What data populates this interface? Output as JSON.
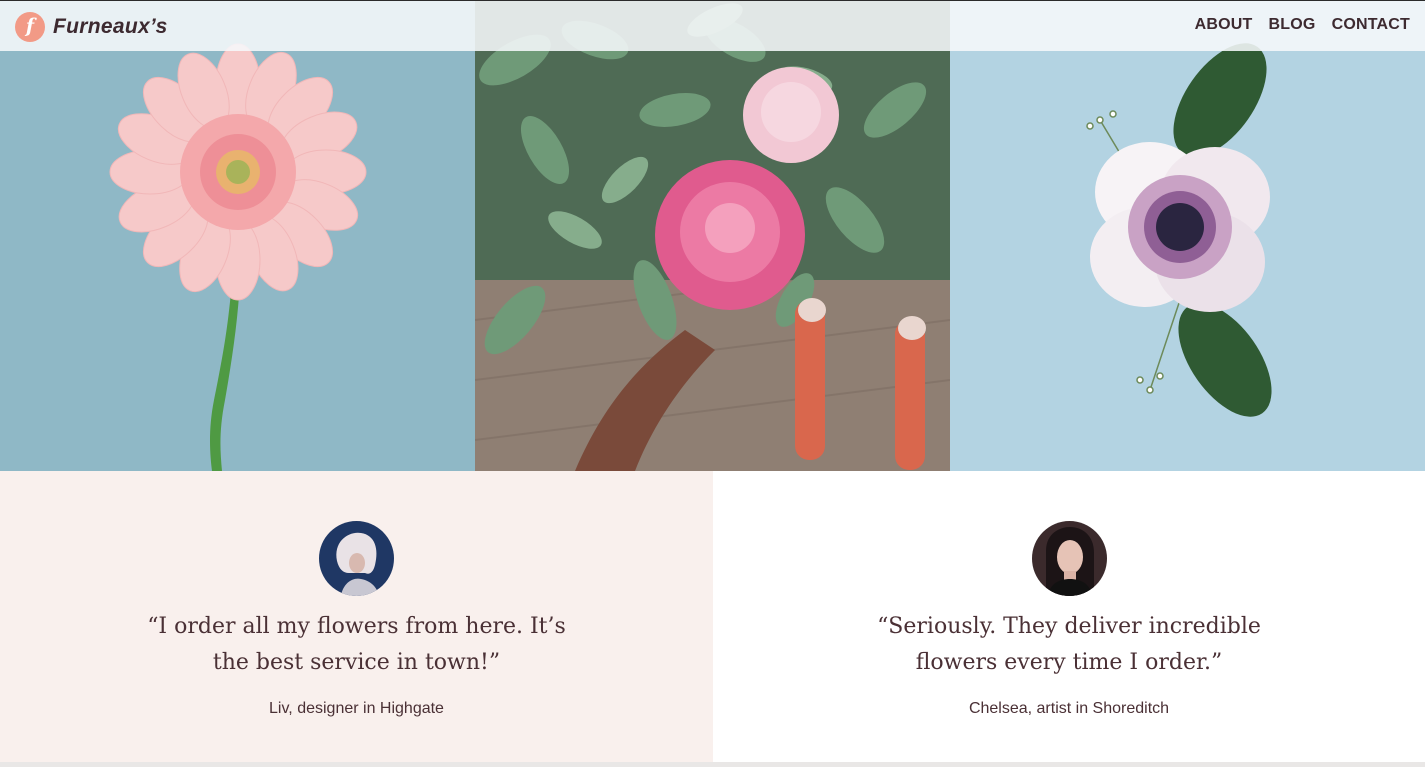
{
  "brand": {
    "logo_letter": "f",
    "name": "Furneaux’s"
  },
  "nav": {
    "about": "ABOUT",
    "blog": "BLOG",
    "contact": "CONTACT"
  },
  "testimonials": [
    {
      "quote": "“I order all my flowers from here. It’s the best service in town!”",
      "author": "Liv, designer in Highgate"
    },
    {
      "quote": "“Seriously. They deliver incredible flowers every time I order.”",
      "author": "Chelsea, artist in Shoreditch"
    }
  ],
  "colors": {
    "text": "#4a3035",
    "accent": "#f29a86",
    "testimonial_bg": "#f9f0ed"
  }
}
